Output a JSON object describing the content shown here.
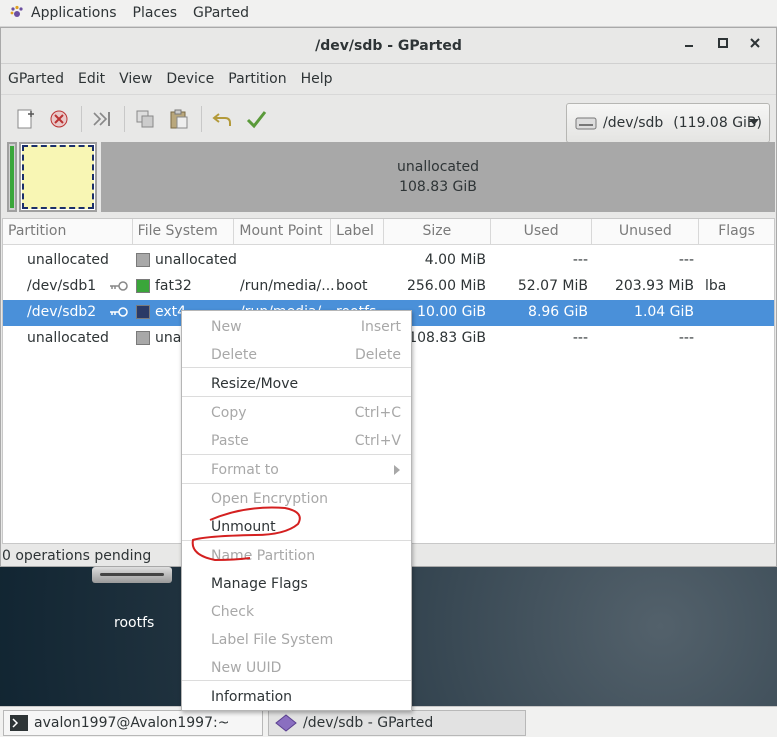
{
  "top_panel": {
    "applications": "Applications",
    "places": "Places",
    "app_name": "GParted"
  },
  "window": {
    "title": "/dev/sdb - GParted"
  },
  "menubar": [
    "GParted",
    "Edit",
    "View",
    "Device",
    "Partition",
    "Help"
  ],
  "toolbar": {
    "buttons": [
      "new-icon",
      "delete-icon",
      "resize-move-icon",
      "copy-icon",
      "paste-icon",
      "undo-icon",
      "apply-icon"
    ]
  },
  "device_combo": {
    "device": "/dev/sdb",
    "size": "(119.08 GiB)"
  },
  "partition_map": {
    "unalloc_label": "unallocated",
    "unalloc_size": "108.83 GiB"
  },
  "table": {
    "columns": [
      "Partition",
      "File System",
      "Mount Point",
      "Label",
      "Size",
      "Used",
      "Unused",
      "Flags"
    ],
    "rows": [
      {
        "partition": "unallocated",
        "fs": "unallocated",
        "fs_color": "#a8a8a8",
        "mount": "",
        "label": "",
        "size": "4.00 MiB",
        "used": "---",
        "unused": "---",
        "flags": "",
        "key": false
      },
      {
        "partition": "/dev/sdb1",
        "fs": "fat32",
        "fs_color": "#3aa63a",
        "mount": "/run/media/...",
        "label": "boot",
        "size": "256.00 MiB",
        "used": "52.07 MiB",
        "unused": "203.93 MiB",
        "flags": "lba",
        "key": true
      },
      {
        "partition": "/dev/sdb2",
        "fs": "ext4",
        "fs_color": "#2a3a66",
        "mount": "/run/media/...",
        "label": "rootfs",
        "size": "10.00 GiB",
        "used": "8.96 GiB",
        "unused": "1.04 GiB",
        "flags": "",
        "key": true
      },
      {
        "partition": "unallocated",
        "fs": "unallocated",
        "fs_color": "#a8a8a8",
        "mount": "",
        "label": "",
        "size": "108.83 GiB",
        "used": "---",
        "unused": "---",
        "flags": "",
        "key": false
      }
    ]
  },
  "status": "0 operations pending",
  "context_menu": {
    "items": [
      {
        "label": "New",
        "accel": "Insert",
        "enabled": false
      },
      {
        "label": "Delete",
        "accel": "Delete",
        "enabled": false
      },
      {
        "label": "Resize/Move",
        "accel": "",
        "enabled": true
      },
      {
        "label": "Copy",
        "accel": "Ctrl+C",
        "enabled": false
      },
      {
        "label": "Paste",
        "accel": "Ctrl+V",
        "enabled": false
      },
      {
        "label": "Format to",
        "accel": "",
        "enabled": false
      },
      {
        "label": "Open Encryption",
        "accel": "",
        "enabled": false
      },
      {
        "label": "Unmount",
        "accel": "",
        "enabled": true
      },
      {
        "label": "Name Partition",
        "accel": "",
        "enabled": false
      },
      {
        "label": "Manage Flags",
        "accel": "",
        "enabled": true
      },
      {
        "label": "Check",
        "accel": "",
        "enabled": false
      },
      {
        "label": "Label File System",
        "accel": "",
        "enabled": false
      },
      {
        "label": "New UUID",
        "accel": "",
        "enabled": false
      },
      {
        "label": "Information",
        "accel": "",
        "enabled": true
      }
    ]
  },
  "desktop": {
    "drive_label": "rootfs"
  },
  "taskbar": {
    "terminal": "avalon1997@Avalon1997:~",
    "gparted": "/dev/sdb - GParted"
  },
  "colors": {
    "selection": "#4a90d9",
    "annotation": "#d42020"
  }
}
